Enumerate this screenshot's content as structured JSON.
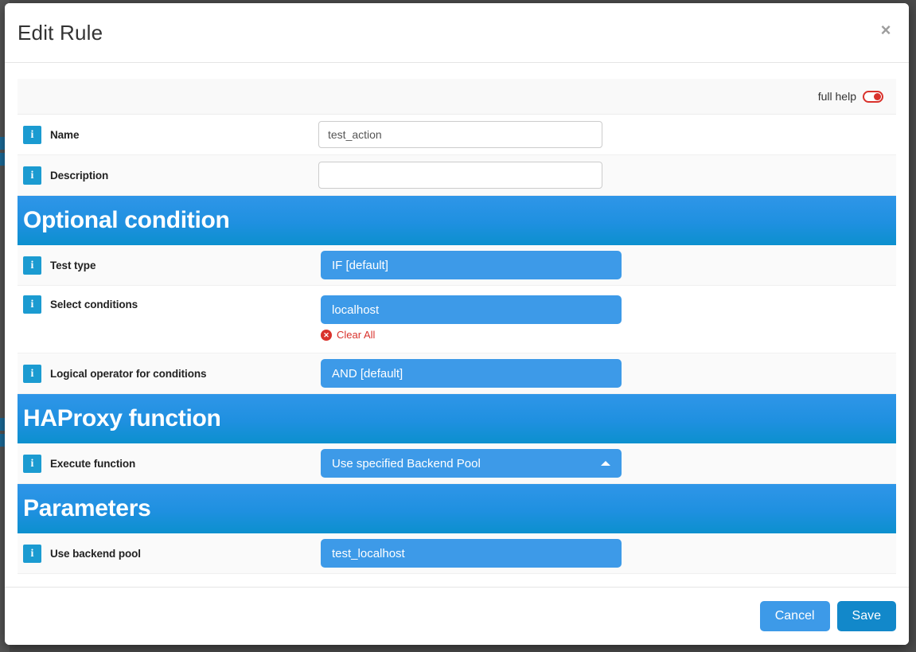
{
  "modal": {
    "title": "Edit Rule",
    "close_icon": "×"
  },
  "help": {
    "label": "full help",
    "toggle_state": "on",
    "toggle_color": "#d9322c"
  },
  "colors": {
    "accent_blue": "#1b9bd1",
    "select_blue": "#3d9ae8",
    "header_blue": "#1f90e0",
    "save_blue": "#1288ca",
    "danger_red": "#d9322c"
  },
  "form": {
    "rows": [
      {
        "label": "Name",
        "type": "text",
        "value": "test_action",
        "placeholder": ""
      },
      {
        "label": "Description",
        "type": "text",
        "value": "",
        "placeholder": ""
      }
    ]
  },
  "sections": [
    {
      "title": "Optional condition",
      "rows": [
        {
          "label": "Test type",
          "type": "select",
          "value": "IF [default]"
        },
        {
          "label": "Select conditions",
          "type": "select",
          "value": "localhost",
          "clear_all": "Clear All",
          "clear_icon": "✕"
        },
        {
          "label": "Logical operator for conditions",
          "type": "select",
          "value": "AND [default]"
        }
      ]
    },
    {
      "title": "HAProxy function",
      "rows": [
        {
          "label": "Execute function",
          "type": "select",
          "value": "Use specified Backend Pool",
          "caret": "caret-up-icon"
        }
      ]
    },
    {
      "title": "Parameters",
      "rows": [
        {
          "label": "Use backend pool",
          "type": "select",
          "value": "test_localhost"
        }
      ]
    }
  ],
  "footer": {
    "cancel_label": "Cancel",
    "save_label": "Save"
  },
  "info_icon_glyph": "i"
}
